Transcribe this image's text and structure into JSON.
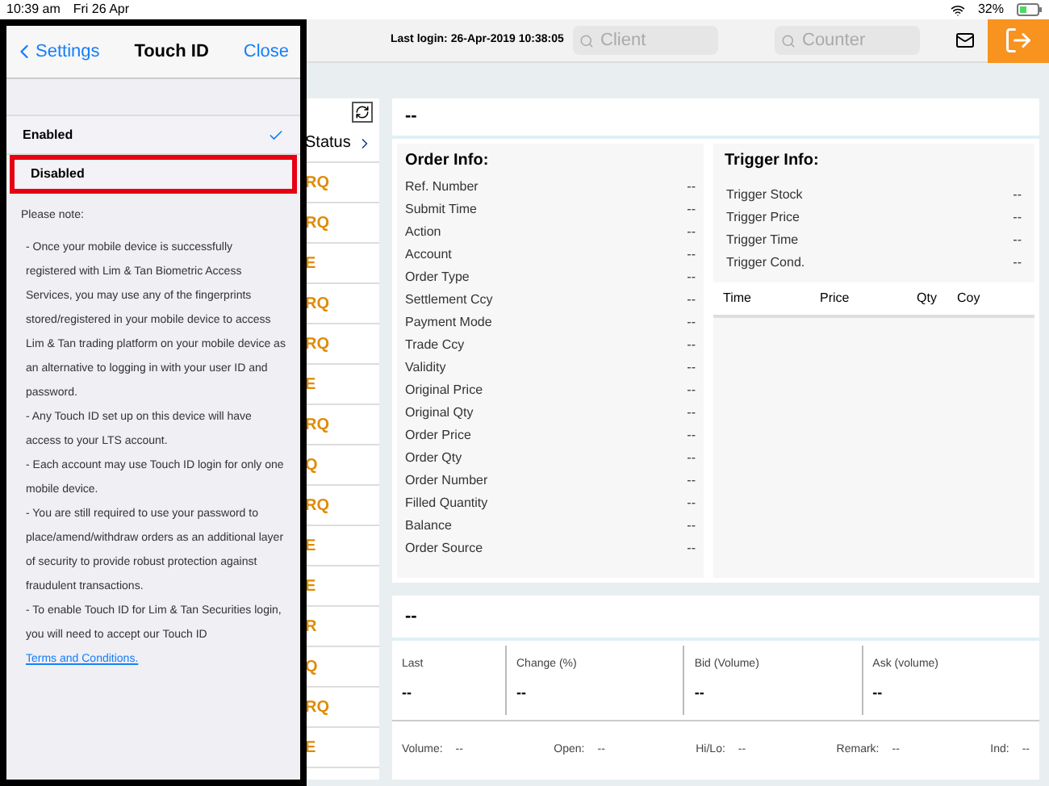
{
  "status_bar": {
    "time": "10:39 am",
    "date": "Fri 26 Apr",
    "battery": "32%"
  },
  "header": {
    "last_login": "Last login: 26-Apr-2019 10:38:05",
    "client_placeholder": "Client",
    "counter_placeholder": "Counter"
  },
  "order_list": {
    "column": "Status",
    "rows": [
      "RQ",
      "RQ",
      "E",
      "RQ",
      "RQ",
      "E",
      "RQ",
      "Q",
      "RQ",
      "E",
      "E",
      "R",
      "Q",
      "RQ",
      "E"
    ]
  },
  "detail": {
    "title": "--",
    "order_info": {
      "title": "Order Info:",
      "rows": [
        {
          "label": "Ref. Number",
          "value": "--"
        },
        {
          "label": "Submit Time",
          "value": "--"
        },
        {
          "label": "Action",
          "value": "--"
        },
        {
          "label": "Account",
          "value": "--"
        },
        {
          "label": "Order Type",
          "value": "--"
        },
        {
          "label": "Settlement Ccy",
          "value": "--"
        },
        {
          "label": "Payment Mode",
          "value": "--"
        },
        {
          "label": "Trade Ccy",
          "value": "--"
        },
        {
          "label": "Validity",
          "value": "--"
        },
        {
          "label": "Original Price",
          "value": "--"
        },
        {
          "label": "Original Qty",
          "value": "--"
        },
        {
          "label": "Order Price",
          "value": "--"
        },
        {
          "label": "Order Qty",
          "value": "--"
        },
        {
          "label": "Order Number",
          "value": "--"
        },
        {
          "label": "Filled Quantity",
          "value": "--"
        },
        {
          "label": "Balance",
          "value": "--"
        },
        {
          "label": "Order Source",
          "value": "--"
        }
      ]
    },
    "trigger_info": {
      "title": "Trigger Info:",
      "rows": [
        {
          "label": "Trigger Stock",
          "value": "--"
        },
        {
          "label": "Trigger Price",
          "value": "--"
        },
        {
          "label": "Trigger Time",
          "value": "--"
        },
        {
          "label": "Trigger Cond.",
          "value": "--"
        }
      ],
      "columns": [
        "Time",
        "Price",
        "Qty",
        "Coy"
      ]
    }
  },
  "quote": {
    "title": "--",
    "cells": [
      {
        "label": "Last",
        "value": "--"
      },
      {
        "label": "Change (%)",
        "value": "--"
      },
      {
        "label": "Bid (Volume)",
        "value": "--"
      },
      {
        "label": "Ask (volume)",
        "value": "--"
      }
    ],
    "stats": [
      {
        "label": "Volume:",
        "value": "--"
      },
      {
        "label": "Open:",
        "value": "--"
      },
      {
        "label": "Hi/Lo:",
        "value": "--"
      },
      {
        "label": "Remark:",
        "value": "--"
      },
      {
        "label": "Ind:",
        "value": "--"
      }
    ]
  },
  "touch_id": {
    "back": "Settings",
    "title": "Touch ID",
    "close": "Close",
    "options": [
      {
        "label": "Enabled",
        "selected": true,
        "highlighted": false
      },
      {
        "label": "Disabled",
        "selected": false,
        "highlighted": true
      }
    ],
    "note_title": "Please note:",
    "notes": [
      {
        "text": "- Once your mobile device is successfully registered with Lim & Tan Biometric Access Services, you may use any of the fingerprints stored/registered in your mobile device to access Lim & Tan trading platform on your mobile device as an alternative to logging in with your user ID and password."
      },
      {
        "text": "- Any Touch ID set up on this device will have access to your LTS account."
      },
      {
        "text": "- Each account may use Touch ID login for only one mobile device."
      },
      {
        "text": "- You are still required to use your password to place/amend/withdraw orders as an additional layer of security to provide robust protection against fraudulent transactions."
      },
      {
        "text": "- To enable Touch ID for Lim & Tan Securities login, you will need to accept our Touch ID",
        "link": "Terms and Conditions."
      }
    ]
  }
}
